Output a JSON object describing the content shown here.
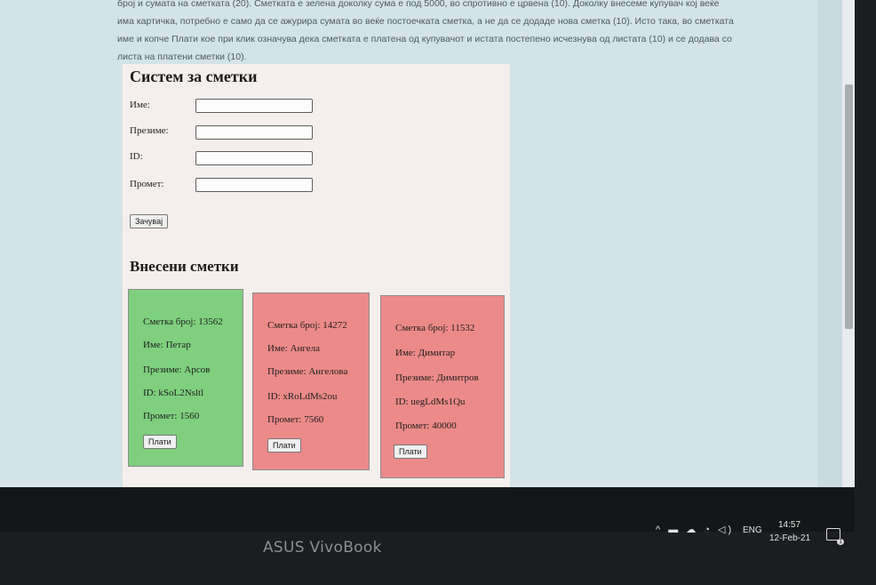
{
  "intro": {
    "line1": "број и сумата на сметката (20). Сметката е зелена доколку сума е под 5000, во спротивно е црвена (10). Доколку внесеме купувач кој веќе",
    "line2": "има картичка, потребно е само да се ажурира сумата во веќе постоечката сметка, а не да се додаде нова сметка (10). Исто така, во сметката",
    "line3": "име и копче Плати кое при клик означува дека сметката е платена од купувачот и истата постепено исчезнува од листата (10) и се додава со",
    "line4": "листа на платени сметки (10)."
  },
  "app": {
    "title": "Систем за сметки",
    "form": {
      "name_label": "Име:",
      "surname_label": "Презиме:",
      "id_label": "ID:",
      "turnover_label": "Промет:",
      "save_label": "Зачувај"
    },
    "list_title": "Внесени сметки",
    "cards": [
      {
        "number": "Сметка број: 13562",
        "name": "Име: Петар",
        "surname": "Презиме: Арсов",
        "id": "ID: kSoL2Nsltl",
        "turnover": "Промет: 1560",
        "pay_label": "Плати",
        "color": "#7ed07e"
      },
      {
        "number": "Сметка број: 14272",
        "name": "Име: Ангела",
        "surname": "Презиме: Ангелова",
        "id": "ID: xRoLdMs2ou",
        "turnover": "Промет: 7560",
        "pay_label": "Плати",
        "color": "#ec8a8a"
      },
      {
        "number": "Сметка број: 11532",
        "name": "Име: Димитар",
        "surname": "Презиме: Димитров",
        "id": "ID: uegLdMs1Qu",
        "turnover": "Промет: 40000",
        "pay_label": "Плати",
        "color": "#ec8a8a"
      }
    ]
  },
  "taskbar": {
    "tray_icons": "^ ▬ ☁ ◔ ◁)",
    "language": "ENG",
    "time": "14:57",
    "date": "12-Feb-21",
    "notification_count": "1"
  },
  "laptop_brand": "ASUS VivoBook"
}
